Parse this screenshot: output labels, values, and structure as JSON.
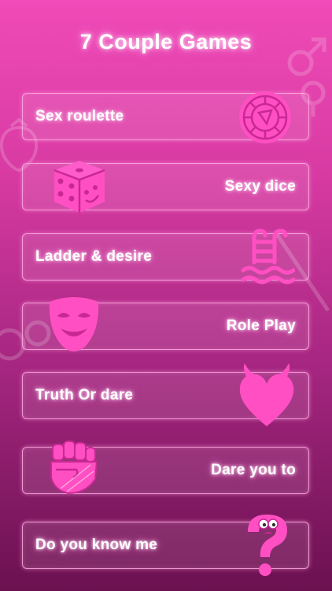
{
  "header": {
    "title": "7 Couple Games"
  },
  "games": [
    {
      "label": "Sex roulette",
      "icon": "roulette-icon"
    },
    {
      "label": "Sexy dice",
      "icon": "dice-icon"
    },
    {
      "label": "Ladder & desire",
      "icon": "ladder-pool-icon"
    },
    {
      "label": "Role Play",
      "icon": "theater-mask-icon"
    },
    {
      "label": "Truth Or dare",
      "icon": "devil-heart-icon"
    },
    {
      "label": "Dare you to",
      "icon": "raised-fist-icon"
    },
    {
      "label": "Do you know me",
      "icon": "question-mark-character-icon"
    }
  ],
  "colors": {
    "accent": "#ff4fc2",
    "glow": "#ffb0e6",
    "text": "#ffffff"
  }
}
